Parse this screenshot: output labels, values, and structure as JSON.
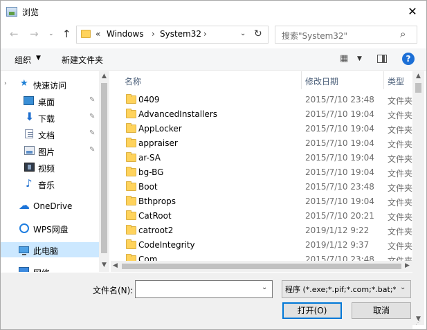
{
  "window": {
    "title": "浏览",
    "close_glyph": "✕"
  },
  "nav": {
    "back_glyph": "←",
    "forward_glyph": "→",
    "recent_glyph": "⌄",
    "up_glyph": "↑",
    "address": {
      "overflow": "«",
      "segments": [
        "Windows",
        "System32"
      ],
      "sep": "›",
      "drop_glyph": "⌄",
      "refresh_glyph": "↻"
    },
    "search": {
      "placeholder": "搜索\"System32\"",
      "icon_glyph": "⌕"
    }
  },
  "toolbar": {
    "organize_label": "组织",
    "organize_arrow": "▼",
    "new_folder_label": "新建文件夹",
    "view_glyph": "▦",
    "view_arrow": "▼",
    "help_glyph": "?"
  },
  "sidebar": {
    "quick_access": {
      "label": "快速访问",
      "expand_glyph": "›",
      "icon_glyph": "★"
    },
    "items": [
      {
        "label": "桌面",
        "pinned": true
      },
      {
        "label": "下载",
        "pinned": true
      },
      {
        "label": "文档",
        "pinned": true
      },
      {
        "label": "图片",
        "pinned": true
      },
      {
        "label": "视频",
        "pinned": false
      },
      {
        "label": "音乐",
        "pinned": false
      }
    ],
    "pin_glyph": "✎",
    "onedrive_label": "OneDrive",
    "wps_label": "WPS网盘",
    "thispc_label": "此电脑",
    "network_label": "网络",
    "scroll_up": "▲",
    "scroll_down": "▼"
  },
  "list": {
    "sort_indicator": "^",
    "columns": {
      "name": "名称",
      "date": "修改日期",
      "type": "类型"
    },
    "rows": [
      {
        "name": "0409",
        "date": "2015/7/10 23:48",
        "type": "文件夹"
      },
      {
        "name": "AdvancedInstallers",
        "date": "2015/7/10 19:04",
        "type": "文件夹"
      },
      {
        "name": "AppLocker",
        "date": "2015/7/10 19:04",
        "type": "文件夹"
      },
      {
        "name": "appraiser",
        "date": "2015/7/10 19:04",
        "type": "文件夹"
      },
      {
        "name": "ar-SA",
        "date": "2015/7/10 19:04",
        "type": "文件夹"
      },
      {
        "name": "bg-BG",
        "date": "2015/7/10 19:04",
        "type": "文件夹"
      },
      {
        "name": "Boot",
        "date": "2015/7/10 23:48",
        "type": "文件夹"
      },
      {
        "name": "Bthprops",
        "date": "2015/7/10 19:04",
        "type": "文件夹"
      },
      {
        "name": "CatRoot",
        "date": "2015/7/10 20:21",
        "type": "文件夹"
      },
      {
        "name": "catroot2",
        "date": "2019/1/12 9:22",
        "type": "文件夹"
      },
      {
        "name": "CodeIntegrity",
        "date": "2019/1/12 9:37",
        "type": "文件夹"
      },
      {
        "name": "Com",
        "date": "2015/7/10 23:48",
        "type": "文件夹"
      }
    ],
    "scroll_up": "▲",
    "scroll_down": "▼",
    "scroll_left": "◀",
    "scroll_right": "▶"
  },
  "bottom": {
    "filename_label": "文件名(N):",
    "filename_value": "",
    "filename_drop": "⌄",
    "filter_value": "程序 (*.exe;*.pif;*.com;*.bat;*.",
    "filter_drop": "⌄",
    "open_label": "打开(O)",
    "cancel_label": "取消",
    "grip": "⋰"
  }
}
